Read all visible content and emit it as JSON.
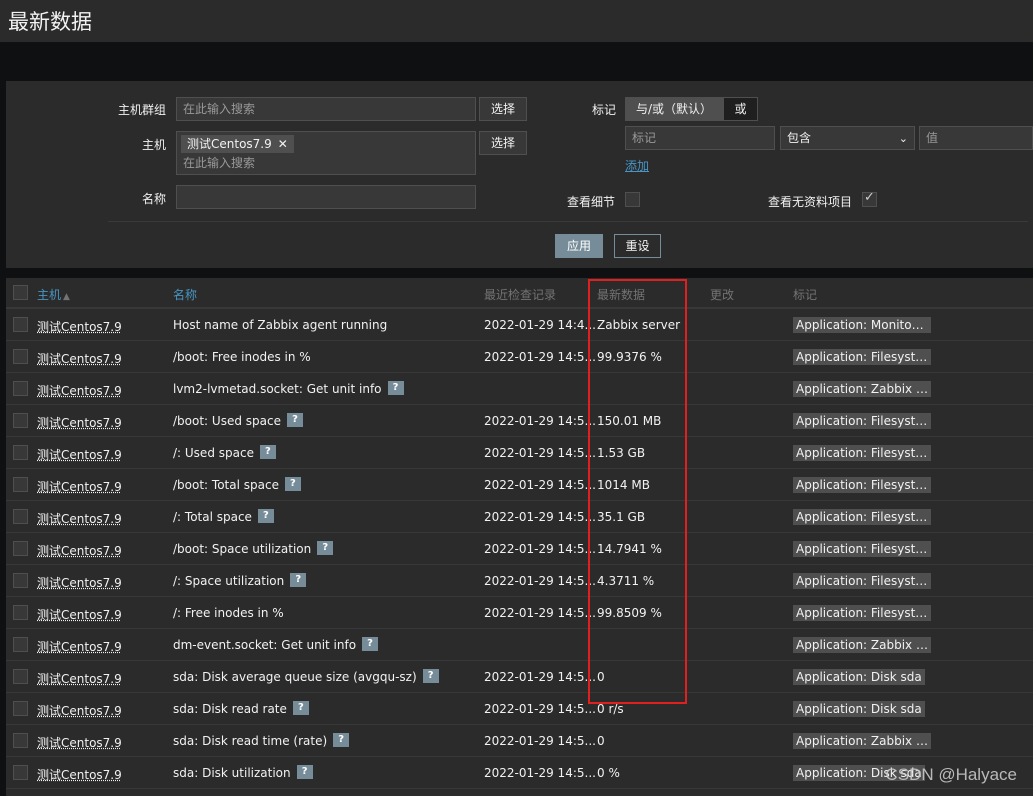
{
  "page": {
    "title": "最新数据"
  },
  "filter": {
    "host_group_label": "主机群组",
    "host_group_placeholder": "在此输入搜索",
    "host_label": "主机",
    "host_chip": "测试Centos7.9",
    "host_placeholder": "在此输入搜索",
    "name_label": "名称",
    "name_value": "",
    "select_label": "选择",
    "tags_label": "标记",
    "tags_and_or": "与/或（默认）",
    "tags_or": "或",
    "tag_placeholder": "标记",
    "tag_operator": "包含",
    "tag_value_placeholder": "值",
    "add_link": "添加",
    "show_details_label": "查看细节",
    "show_without_data_label": "查看无资料项目",
    "apply": "应用",
    "reset": "重设"
  },
  "table": {
    "columns": {
      "host": "主机",
      "name": "名称",
      "last_check": "最近检查记录",
      "last_value": "最新数据",
      "change": "更改",
      "tags": "标记"
    },
    "sort_indicator": "▲",
    "help_icon": "?",
    "rows": [
      {
        "host": "测试Centos7.9",
        "name": "Host name of Zabbix agent running",
        "help": false,
        "last_check": "2022-01-29 14:4...",
        "last_value": "Zabbix server",
        "change": "",
        "tag": "Application: Monitorin..."
      },
      {
        "host": "测试Centos7.9",
        "name": "/boot: Free inodes in %",
        "help": false,
        "last_check": "2022-01-29 14:5...",
        "last_value": "99.9376 %",
        "change": "",
        "tag": "Application: Filesyste..."
      },
      {
        "host": "测试Centos7.9",
        "name": "lvm2-lvmetad.socket: Get unit info",
        "help": true,
        "last_check": "",
        "last_value": "",
        "change": "",
        "tag": "Application: Zabbix ra..."
      },
      {
        "host": "测试Centos7.9",
        "name": "/boot: Used space",
        "help": true,
        "last_check": "2022-01-29 14:5...",
        "last_value": "150.01 MB",
        "change": "",
        "tag": "Application: Filesyste..."
      },
      {
        "host": "测试Centos7.9",
        "name": "/: Used space",
        "help": true,
        "last_check": "2022-01-29 14:5...",
        "last_value": "1.53 GB",
        "change": "",
        "tag": "Application: Filesystem /"
      },
      {
        "host": "测试Centos7.9",
        "name": "/boot: Total space",
        "help": true,
        "last_check": "2022-01-29 14:5...",
        "last_value": "1014 MB",
        "change": "",
        "tag": "Application: Filesyste..."
      },
      {
        "host": "测试Centos7.9",
        "name": "/: Total space",
        "help": true,
        "last_check": "2022-01-29 14:5...",
        "last_value": "35.1 GB",
        "change": "",
        "tag": "Application: Filesystem /"
      },
      {
        "host": "测试Centos7.9",
        "name": "/boot: Space utilization",
        "help": true,
        "last_check": "2022-01-29 14:5...",
        "last_value": "14.7941 %",
        "change": "",
        "tag": "Application: Filesyste..."
      },
      {
        "host": "测试Centos7.9",
        "name": "/: Space utilization",
        "help": true,
        "last_check": "2022-01-29 14:5...",
        "last_value": "4.3711 %",
        "change": "",
        "tag": "Application: Filesystem /"
      },
      {
        "host": "测试Centos7.9",
        "name": "/: Free inodes in %",
        "help": false,
        "last_check": "2022-01-29 14:5...",
        "last_value": "99.8509 %",
        "change": "",
        "tag": "Application: Filesystem /"
      },
      {
        "host": "测试Centos7.9",
        "name": "dm-event.socket: Get unit info",
        "help": true,
        "last_check": "",
        "last_value": "",
        "change": "",
        "tag": "Application: Zabbix ra..."
      },
      {
        "host": "测试Centos7.9",
        "name": "sda: Disk average queue size (avgqu-sz)",
        "help": true,
        "last_check": "2022-01-29 14:5...",
        "last_value": "0",
        "change": "",
        "tag": "Application: Disk sda"
      },
      {
        "host": "测试Centos7.9",
        "name": "sda: Disk read rate",
        "help": true,
        "last_check": "2022-01-29 14:5...",
        "last_value": "0 r/s",
        "change": "",
        "tag": "Application: Disk sda"
      },
      {
        "host": "测试Centos7.9",
        "name": "sda: Disk read time (rate)",
        "help": true,
        "last_check": "2022-01-29 14:5...",
        "last_value": "0",
        "change": "",
        "tag": "Application: Zabbix ra..."
      },
      {
        "host": "测试Centos7.9",
        "name": "sda: Disk utilization",
        "help": true,
        "last_check": "2022-01-29 14:5...",
        "last_value": "0 %",
        "change": "",
        "tag": "Application: Disk sda"
      }
    ]
  },
  "watermark": "CSDN @Halyace",
  "colors": {
    "accent": "#4796c4",
    "highlight_box": "#e0201e",
    "button": "#768d99"
  }
}
